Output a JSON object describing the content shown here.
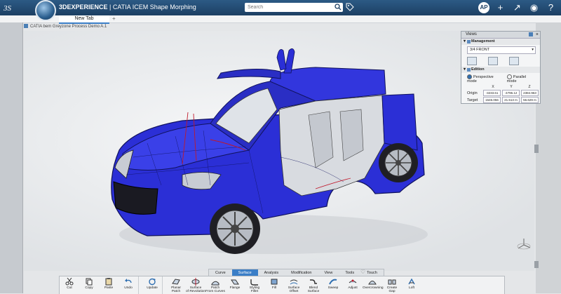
{
  "app": {
    "brand": "3DEXPERIENCE",
    "separator": " | ",
    "product": "CATIA ICEM Shape Morphing"
  },
  "search": {
    "placeholder": "Search"
  },
  "tabs": [
    {
      "label": "New Tab"
    }
  ],
  "tab_add": "+",
  "document": {
    "title": "CATIA bem Greyzone Process Demo A.1"
  },
  "views_panel": {
    "title": "Views",
    "close": "×",
    "management": {
      "label": "Management",
      "selected_view": "3/4 FRONT"
    },
    "edition": {
      "label": "Edition",
      "perspective_label": "Perspective mode",
      "parallel_label": "Parallel mode",
      "selected_mode": "perspective",
      "axes": [
        "X",
        "Y",
        "Z"
      ],
      "origin": {
        "label": "Origin",
        "values": [
          "-3233.61",
          "-4796.12",
          "2384.963"
        ]
      },
      "target": {
        "label": "Target",
        "values": [
          "1546.056",
          "21.513 m",
          "56.629 m"
        ]
      }
    }
  },
  "action_tabs": [
    {
      "label": "Curve",
      "active": false
    },
    {
      "label": "Surface",
      "active": true
    },
    {
      "label": "Analysis",
      "active": false
    },
    {
      "label": "Modification",
      "active": false
    },
    {
      "label": "View",
      "active": false
    },
    {
      "label": "Tools",
      "active": false
    },
    {
      "label": "Touch",
      "active": false
    }
  ],
  "toolbar": [
    {
      "label": "Cut",
      "icon": "scissors-icon"
    },
    {
      "label": "Copy",
      "icon": "copy-icon"
    },
    {
      "label": "Paste",
      "icon": "paste-icon"
    },
    {
      "label": "Undo",
      "icon": "undo-icon"
    },
    {
      "label": "Update",
      "icon": "update-icon"
    },
    {
      "label": "Planar\nPatch",
      "icon": "planar-patch-icon"
    },
    {
      "label": "Surface\nof Revolution",
      "icon": "surface-of-revolution-icon"
    },
    {
      "label": "Patch\nFrom Curves",
      "icon": "patch-from-curves-icon"
    },
    {
      "label": "Flange",
      "icon": "flange-icon"
    },
    {
      "label": "Styling\nFillet",
      "icon": "styling-fillet-icon"
    },
    {
      "label": "Fill",
      "icon": "fill-icon"
    },
    {
      "label": "Surface\nOffset",
      "icon": "surface-offset-icon"
    },
    {
      "label": "Blend\nSurface",
      "icon": "blend-surface-icon"
    },
    {
      "label": "Sweep",
      "icon": "sweep-icon"
    },
    {
      "label": "Adjust",
      "icon": "adjust-icon"
    },
    {
      "label": "Overcrowning",
      "icon": "overcrowning-icon"
    },
    {
      "label": "Create\nGap",
      "icon": "create-gap-icon"
    },
    {
      "label": "Loft",
      "icon": "loft-icon"
    }
  ],
  "colors": {
    "topbar": "#1c3f63",
    "accent": "#3a7ec7",
    "car_body": "#2b2fd6"
  }
}
